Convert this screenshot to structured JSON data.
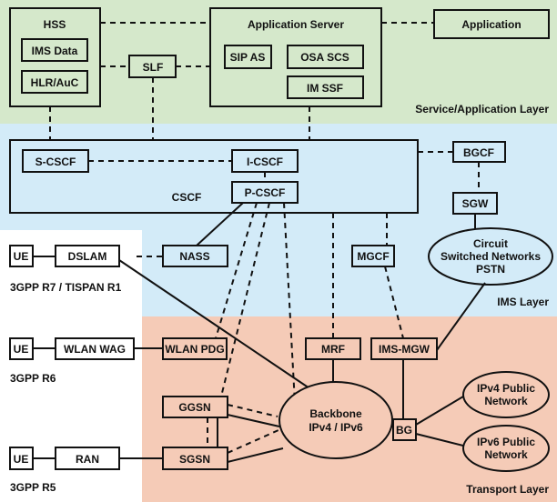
{
  "colors": {
    "service_layer": "#d5e8cb",
    "ims_layer": "#d3ebf8",
    "transport_layer": "#f5cbb7"
  },
  "layers": {
    "service": "Service/Application Layer",
    "ims": "IMS Layer",
    "transport": "Transport Layer"
  },
  "service": {
    "hss": "HSS",
    "ims_data": "IMS Data",
    "hlr_auc": "HLR/AuC",
    "slf": "SLF",
    "app_server": "Application Server",
    "sip_as": "SIP AS",
    "osa_scs": "OSA SCS",
    "im_ssf": "IM SSF",
    "application": "Application"
  },
  "ims": {
    "cscf": "CSCF",
    "s_cscf": "S-CSCF",
    "i_cscf": "I-CSCF",
    "p_cscf": "P-CSCF",
    "bgcf": "BGCF",
    "sgw": "SGW",
    "pstn": [
      "Circuit",
      "Switched Networks",
      "PSTN"
    ],
    "nass": "NASS",
    "mgcf": "MGCF"
  },
  "access": {
    "ue": "UE",
    "dslam": "DSLAM",
    "r7": "3GPP R7 / TISPAN R1",
    "wlan_wag": "WLAN WAG",
    "r6": "3GPP R6",
    "ran": "RAN",
    "r5": "3GPP R5"
  },
  "transport": {
    "wlan_pdg": "WLAN PDG",
    "mrf": "MRF",
    "ims_mgw": "IMS-MGW",
    "ggsn": "GGSN",
    "sgsn": "SGSN",
    "backbone": [
      "Backbone",
      "IPv4 / IPv6"
    ],
    "bg": "BG",
    "ipv4": [
      "IPv4 Public",
      "Network"
    ],
    "ipv6": [
      "IPv6 Public",
      "Network"
    ]
  }
}
